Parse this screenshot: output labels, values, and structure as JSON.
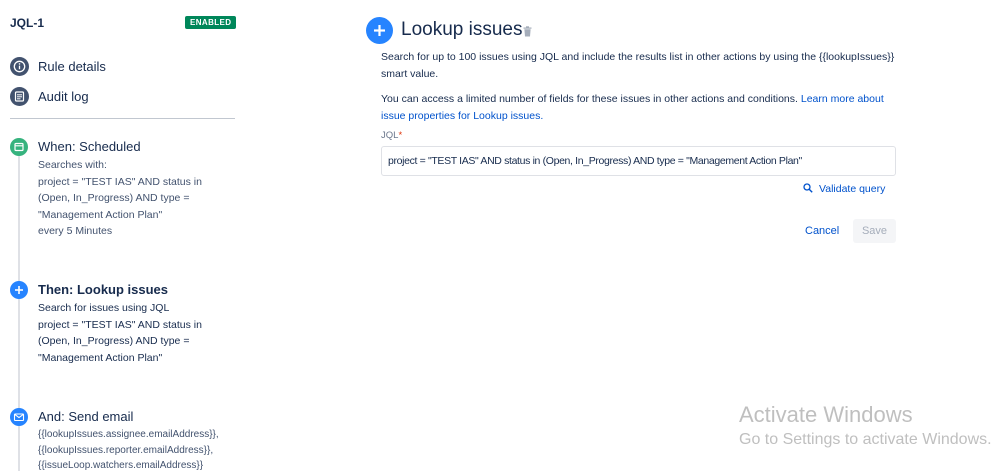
{
  "sidebar": {
    "rule_name": "JQL-1",
    "status_badge": "ENABLED",
    "nav": [
      {
        "label": "Rule details",
        "icon": "info-icon"
      },
      {
        "label": "Audit log",
        "icon": "audit-log-icon"
      }
    ],
    "steps": [
      {
        "title": "When: Scheduled",
        "icon": "clock-icon",
        "color": "#36b37e",
        "lines": [
          "Searches with:",
          "project = \"TEST IAS\" AND status in",
          "(Open, In_Progress) AND type =",
          "\"Management Action Plan\"",
          "every 5 Minutes"
        ]
      },
      {
        "title": "Then: Lookup issues",
        "icon": "plus-icon",
        "color": "#2684ff",
        "lines": [
          "Search for issues using JQL",
          "project = \"TEST IAS\" AND status in",
          "(Open, In_Progress) AND type =",
          "\"Management Action Plan\""
        ]
      },
      {
        "title": "And: Send email",
        "icon": "mail-icon",
        "color": "#2684ff",
        "lines": [
          "{{lookupIssues.assignee.emailAddress}},",
          "{{lookupIssues.reporter.emailAddress}},",
          "{{issueLoop.watchers.emailAddress}}"
        ]
      }
    ]
  },
  "panel": {
    "title": "Lookup issues",
    "description_1": "Search for up to 100 issues using JQL and include the results list in other actions by using the {{lookupIssues}} smart value.",
    "description_2_text": "You can access a limited number of fields for these issues in other actions and conditions. ",
    "description_2_link": "Learn more about issue properties for Lookup issues.",
    "jql_label": "JQL",
    "jql_required_mark": "*",
    "jql_value": "project = \"TEST IAS\" AND status in (Open, In_Progress) AND type = \"Management Action Plan\"",
    "validate_label": "Validate query",
    "cancel_label": "Cancel",
    "save_label": "Save"
  },
  "watermark": {
    "title": "Activate Windows",
    "subtitle": "Go to Settings to activate Windows."
  },
  "colors": {
    "accent": "#2684ff",
    "link": "#0052cc",
    "enabled_badge": "#00875a",
    "scheduled_icon": "#36b37e"
  }
}
